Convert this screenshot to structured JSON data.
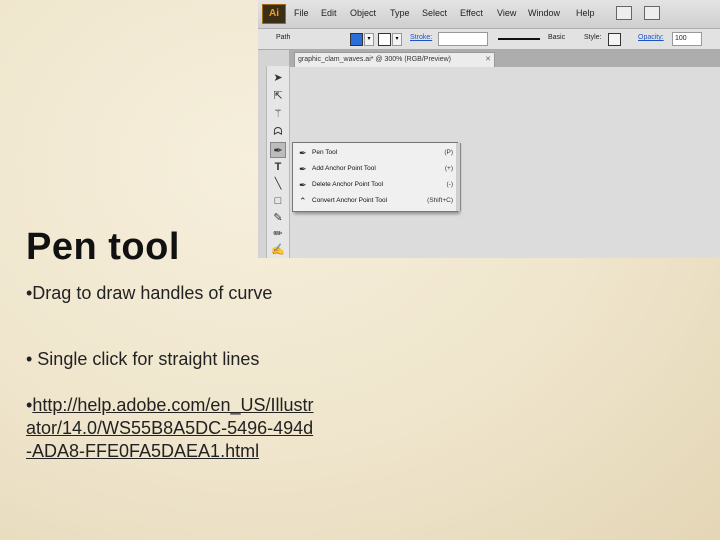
{
  "slide": {
    "title": "Pen tool",
    "bullet1": "•Drag to draw handles of curve",
    "bullet2": "•  Single click for straight lines",
    "bullet3_prefix": "•",
    "link": "http://help.adobe.com/en_US/Illustrator/14.0/WS55B8A5DC-5496-494d-ADA8-FFE0FA5DAEA1.html"
  },
  "screenshot": {
    "logo": "Ai",
    "menu": [
      "File",
      "Edit",
      "Object",
      "Type",
      "Select",
      "Effect",
      "View",
      "Window",
      "Help"
    ],
    "control_bar": {
      "path_label": "Path",
      "stroke_label": "Stroke:",
      "basic_label": "Basic",
      "style_label": "Style:",
      "opacity_label": "Opacity:",
      "opacity_value": "100",
      "fill_color": "#2b6fd6"
    },
    "document_tab": "graphic_clam_waves.ai* @ 300% (RGB/Preview)",
    "tools": [
      "selection-arrow",
      "direct-select",
      "magic-wand",
      "lasso",
      "pen",
      "type",
      "line",
      "rectangle",
      "paintbrush",
      "pencil",
      "eraser",
      "rotate"
    ],
    "flyout": [
      {
        "icon": "pen-icon",
        "label": "Pen Tool",
        "key": "(P)"
      },
      {
        "icon": "add-anchor-icon",
        "label": "Add Anchor Point Tool",
        "key": "(+)"
      },
      {
        "icon": "delete-anchor-icon",
        "label": "Delete Anchor Point Tool",
        "key": "(-)"
      },
      {
        "icon": "convert-anchor-icon",
        "label": "Convert Anchor Point Tool",
        "key": "(Shift+C)"
      }
    ]
  }
}
